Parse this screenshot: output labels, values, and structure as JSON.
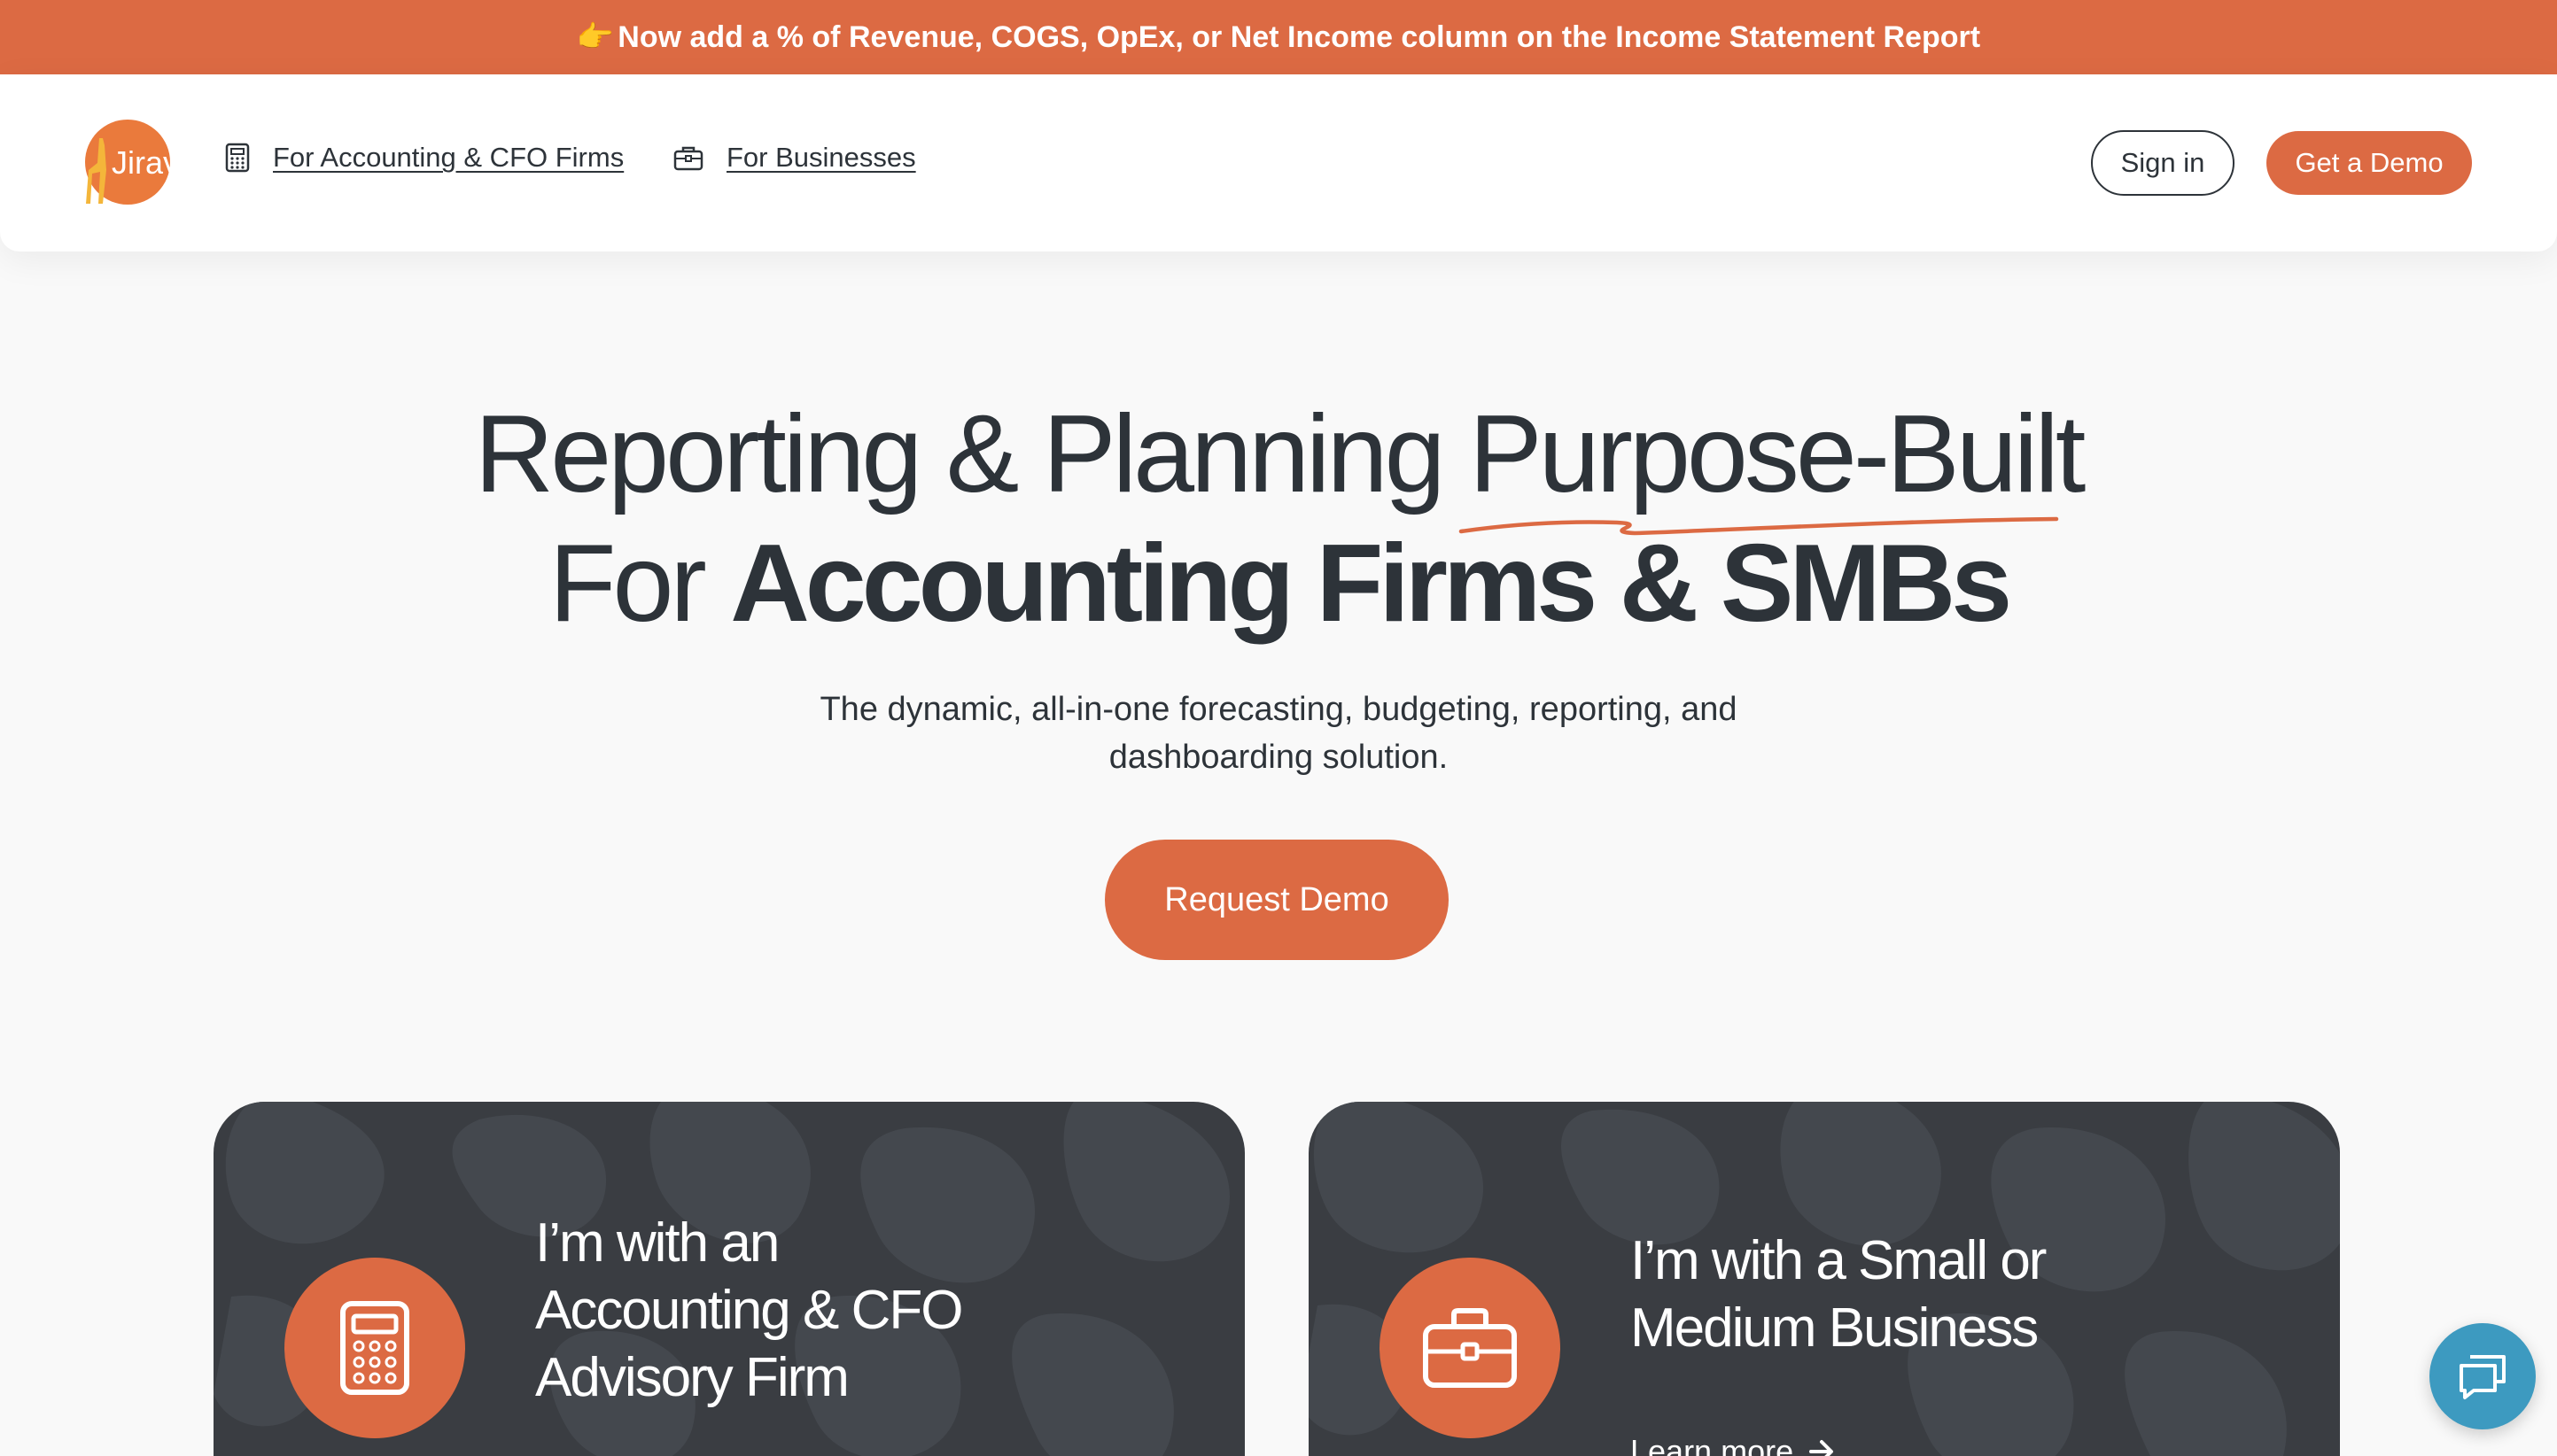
{
  "announcement": {
    "emoji": "👉",
    "text": "Now add a % of Revenue, COGS, OpEx, or Net Income column on the Income Statement Report"
  },
  "brand": {
    "logo_text": "Jirav",
    "accent_color": "#dc6a43",
    "dark_color": "#2d3339"
  },
  "nav": {
    "links": [
      {
        "label": "For Accounting & CFO Firms",
        "icon": "calculator-icon"
      },
      {
        "label": "For Businesses",
        "icon": "briefcase-icon"
      }
    ],
    "signin_label": "Sign in",
    "demo_label": "Get a Demo"
  },
  "hero": {
    "title_line1": "Reporting & Planning Purpose-Built",
    "title_line2_prefix": "For ",
    "title_line2_bold": "Accounting Firms & SMBs",
    "subtitle": "The dynamic, all-in-one forecasting, budgeting, reporting, and dashboarding solution.",
    "cta_label": "Request Demo"
  },
  "cards": [
    {
      "title": "I’m with an Accounting & CFO Advisory Firm",
      "icon": "calculator-icon"
    },
    {
      "title": "I’m with a Small or Medium Business",
      "icon": "briefcase-icon",
      "link_label": "Learn more"
    }
  ],
  "chat": {
    "icon": "chat-icon",
    "color": "#3d9ac0"
  }
}
